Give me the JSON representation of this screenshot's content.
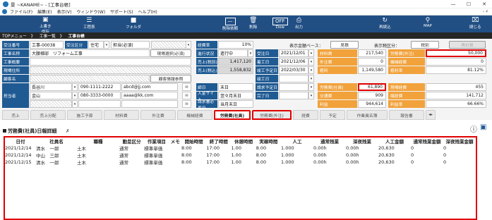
{
  "window": {
    "title": "景 ~KANAME~ - [工事台帳]",
    "min": "—",
    "max": "☐",
    "close": "✕"
  },
  "menu": [
    "ファイル(F)",
    "編集(E)",
    "表示(V)",
    "ウィンドウ(W)",
    "サポート(S)",
    "ヘルプ(H)"
  ],
  "menu_right": "- ♯",
  "toolbar": {
    "overwrite": "上書き\n保存",
    "overwrite_1": "上書き",
    "overwrite_2": "保存",
    "schedule": "工程表",
    "folder": "フォルダ",
    "delete_req": "削除依頼",
    "delete": "削除",
    "dow": "Dow",
    "output": "出力",
    "refresh": "再読込",
    "map": "MAP",
    "close": "閉じる",
    "off": "OFF"
  },
  "breadcrumb": [
    "TOPメニュー",
    "》",
    "工事一覧",
    "》",
    "工事台帳"
  ],
  "form": {
    "order_no_label": "受注番号",
    "order_no": "工事-00038",
    "order_type_label": "受注区分",
    "order_type": "住宅",
    "owner": "担当(必須)",
    "name_label": "工事名称",
    "name": "大腰様邸　リフォーム工事",
    "site_btn": "現場選択(必須)",
    "summary_label": "工事概要",
    "address_label": "現場住所",
    "client_label": "顧客名",
    "client_btn": "顧客情報参照",
    "rep_label": "担当者",
    "rep1_name": "長谷川",
    "rep1_tel": "090-1111-2222",
    "rep1_mail": "abcd@jj.com",
    "rep2_name": "金山",
    "rep2_tel": "080-3333-0000",
    "rep2_mail": "aaaa@kk.com",
    "expense_label": "経費率",
    "expense": "10%",
    "status_label": "進行状況",
    "status": "進行中",
    "sales_ex_label": "売上(税別)",
    "sales_ex": "1,417,120",
    "sales_in_label": "売上(税込)",
    "sales_in": "1,558,832",
    "closing_label": "締日",
    "closing": "末日",
    "site_label": "入金サイト",
    "site": "翌々月末日",
    "billing_label": "請求書必着日",
    "billing": "当月末日",
    "order_date_label": "受注日",
    "order_date": "2021/12/01",
    "start_label": "着工日",
    "start": "2021/12/06",
    "end_plan_label": "竣工予定日",
    "end_plan": "2022/03/30",
    "end_label": "竣工日",
    "bill_plan_label": "請求予定日",
    "done_label": "完了日",
    "basis_label": "表示金額ベース：",
    "basis": "見積",
    "display_label": "表示税区分：",
    "display": "税別",
    "calc_btn": "再計算"
  },
  "costs": {
    "material_label": "材料費",
    "material": "217,540",
    "outsource_label": "外注費",
    "outsource": "0",
    "gross_label": "粗利",
    "gross": "1,149,580",
    "labor_emp_label": "労務費(社員)",
    "labor_emp": "61,890",
    "transport_label": "交通費",
    "transport": "909",
    "profit_label": "利益",
    "profit": "944,614",
    "labor_out_label": "労務費(外注)",
    "labor_out": "50,000",
    "machine_label": "機械経費",
    "machine": "0",
    "gross_rate_label": "粗利率",
    "gross_rate": "81.12%",
    "misc_label": "現場経費",
    "misc": "455",
    "total_label": "諸経費",
    "total": "141,712",
    "profit_rate_label": "利益率",
    "profit_rate": "66.66%"
  },
  "tabs": [
    "売上",
    "売上分配",
    "施工予算",
    "材料費",
    "外注費",
    "機械経費",
    "労務費(社員)",
    "労務費(外注)",
    "経費",
    "予定",
    "作業員名簿",
    "報告書"
  ],
  "section": {
    "title": "労務費(社員)日報詳細",
    "edit_icon": "✗"
  },
  "grid": {
    "headers": [
      "日付",
      "社員名",
      "職種",
      "勤怠区分",
      "作業項目",
      "メモ",
      "開始時間",
      "終了時間",
      "休憩時間",
      "実稼時間",
      "人工",
      "通常残業",
      "深夜残業",
      "人工金額",
      "通常残業金額",
      "深夜残業金額"
    ],
    "rows": [
      [
        "2021/12/14",
        "清水　一郎",
        "土木",
        "通常",
        "標準単価",
        "",
        "8:00",
        "17:00",
        "1.00",
        "8.00",
        "1.000",
        "0.00h",
        "0.00h",
        "20,630",
        "0",
        "0"
      ],
      [
        "2021/12/14",
        "中山　三郎",
        "土木",
        "通常",
        "標準単価",
        "",
        "8:00",
        "17:00",
        "1.00",
        "8.00",
        "1.000",
        "0.00h",
        "0.00h",
        "20,630",
        "0",
        "0"
      ],
      [
        "2021/12/15",
        "清水　一郎",
        "土木",
        "通常",
        "標準単価",
        "",
        "8:00",
        "17:00",
        "1.00",
        "8.00",
        "1.000",
        "0.00h",
        "0.00h",
        "20,630",
        "0",
        "0"
      ]
    ]
  }
}
